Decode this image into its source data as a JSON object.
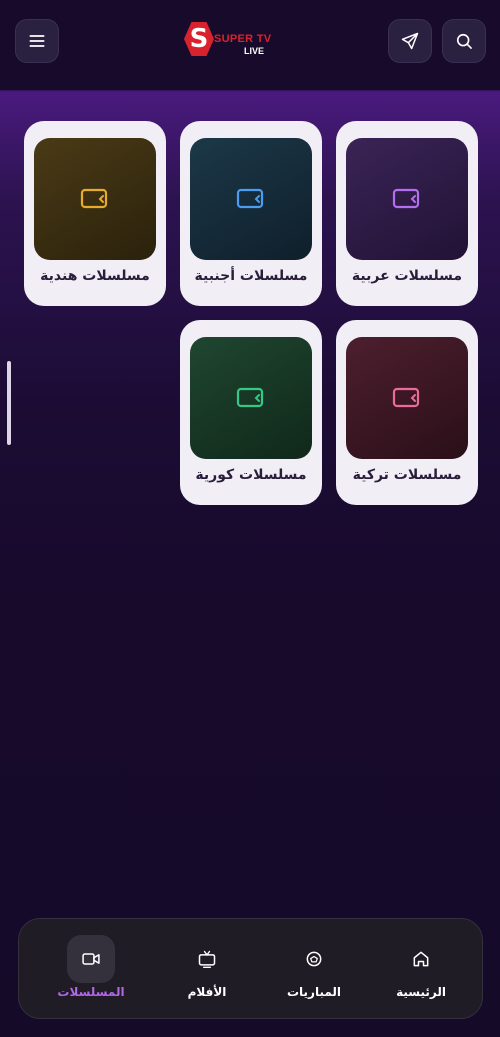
{
  "header": {
    "logo": {
      "badge": "S",
      "top_text": "SUPER TV",
      "bottom_text": "LIVE"
    },
    "icons": {
      "menu": "menu-icon",
      "send": "send-icon",
      "search": "search-icon"
    }
  },
  "categories": [
    {
      "label": "مسلسلات عربية",
      "accent": "#b36ff0"
    },
    {
      "label": "مسلسلات أجنبية",
      "accent": "#4a9df0"
    },
    {
      "label": "مسلسلات هندية",
      "accent": "#e6ac2c"
    },
    {
      "label": "مسلسلات تركية",
      "accent": "#ec6b9c"
    },
    {
      "label": "مسلسلات كورية",
      "accent": "#34c986"
    }
  ],
  "bottom_nav": {
    "items": [
      {
        "label": "الرئيسية",
        "icon": "home-icon",
        "active": false
      },
      {
        "label": "المباريات",
        "icon": "ball-icon",
        "active": false
      },
      {
        "label": "الأفلام",
        "icon": "tv-icon",
        "active": false
      },
      {
        "label": "المسلسلات",
        "icon": "video-camera-icon",
        "active": true
      }
    ],
    "active_color": "#b067e8"
  }
}
